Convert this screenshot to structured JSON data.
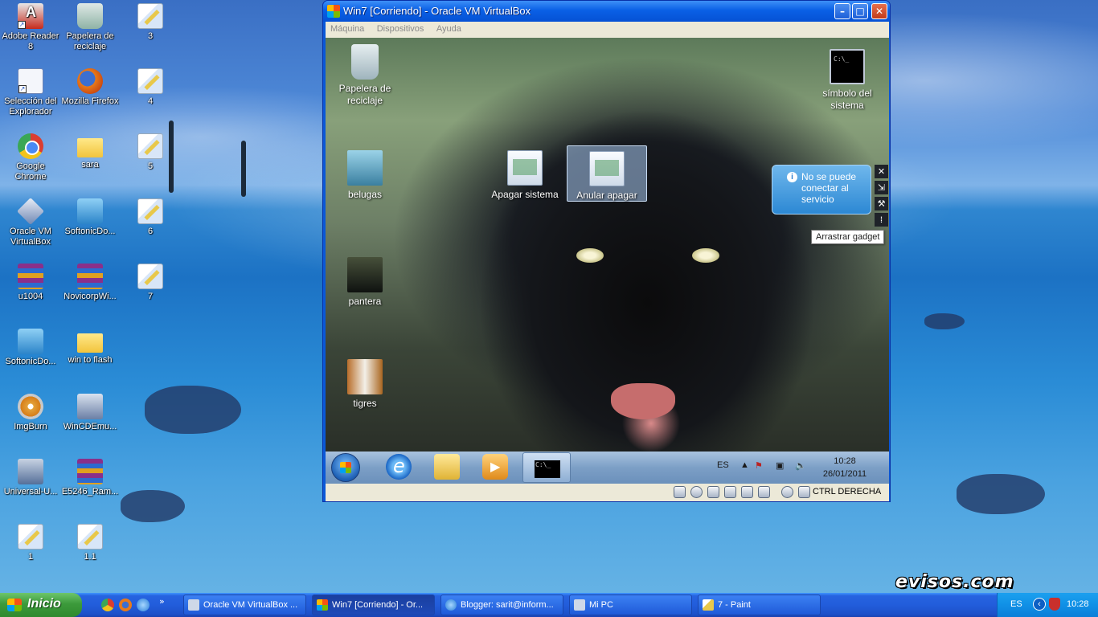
{
  "desktop": {
    "icons": [
      {
        "label": "Adobe Reader 8",
        "icon": "pdf"
      },
      {
        "label": "Papelera de reciclaje",
        "icon": "recycle-bin"
      },
      {
        "label": "3",
        "icon": "paint-file"
      },
      {
        "label": "Selección del Explorador",
        "icon": "explorer-selection"
      },
      {
        "label": "Mozilla Firefox",
        "icon": "firefox"
      },
      {
        "label": "4",
        "icon": "paint-file"
      },
      {
        "label": "Google Chrome",
        "icon": "chrome"
      },
      {
        "label": "sara",
        "icon": "folder"
      },
      {
        "label": "5",
        "icon": "paint-file"
      },
      {
        "label": "Oracle VM VirtualBox",
        "icon": "virtualbox"
      },
      {
        "label": "SoftonicDo...",
        "icon": "softonic"
      },
      {
        "label": "6",
        "icon": "paint-file"
      },
      {
        "label": "u1004",
        "icon": "winrar"
      },
      {
        "label": "NovicorpWi...",
        "icon": "winrar"
      },
      {
        "label": "7",
        "icon": "paint-file"
      },
      {
        "label": "SoftonicDo...",
        "icon": "softonic"
      },
      {
        "label": "win to flash",
        "icon": "folder"
      },
      {
        "label": "ImgBurn",
        "icon": "disc"
      },
      {
        "label": "WinCDEmu...",
        "icon": "wincdemu"
      },
      {
        "label": "Universal-U...",
        "icon": "usb-installer"
      },
      {
        "label": "E5246_Ram...",
        "icon": "winrar"
      },
      {
        "label": "1",
        "icon": "paint-file"
      },
      {
        "label": "1.1",
        "icon": "paint-file"
      }
    ],
    "watermark": "evisos.com"
  },
  "vbox": {
    "title": "Win7 [Corriendo] - Oracle VM VirtualBox",
    "menu": [
      "Máquina",
      "Dispositivos",
      "Ayuda"
    ],
    "guest_icons": [
      {
        "label": "Papelera de reciclaje",
        "icon": "recycle-bin"
      },
      {
        "label": "belugas",
        "icon": "image"
      },
      {
        "label": "pantera",
        "icon": "image"
      },
      {
        "label": "tigres",
        "icon": "image"
      },
      {
        "label": "Apagar sistema",
        "icon": "shortcut"
      },
      {
        "label": "Anular apagar",
        "icon": "shortcut"
      },
      {
        "label": "símbolo del sistema",
        "icon": "cmd"
      }
    ],
    "gadget": {
      "message": "No se puede conectar al servicio",
      "tooltip": "Arrastrar gadget"
    },
    "guest_taskbar": {
      "language": "ES",
      "time": "10:28",
      "date": "26/01/2011"
    },
    "status": {
      "host_key": "CTRL DERECHA"
    }
  },
  "taskbar": {
    "start": "Inicio",
    "tasks": [
      "Oracle VM VirtualBox ...",
      "Win7 [Corriendo] - Or...",
      "Blogger: sarit@inform...",
      "Mi PC",
      "7 - Paint"
    ],
    "language": "ES",
    "clock": "10:28"
  },
  "colors": {
    "xp_blue": "#225ddb",
    "start_green": "#3c9a3b",
    "tray_blue": "#1090e6"
  }
}
